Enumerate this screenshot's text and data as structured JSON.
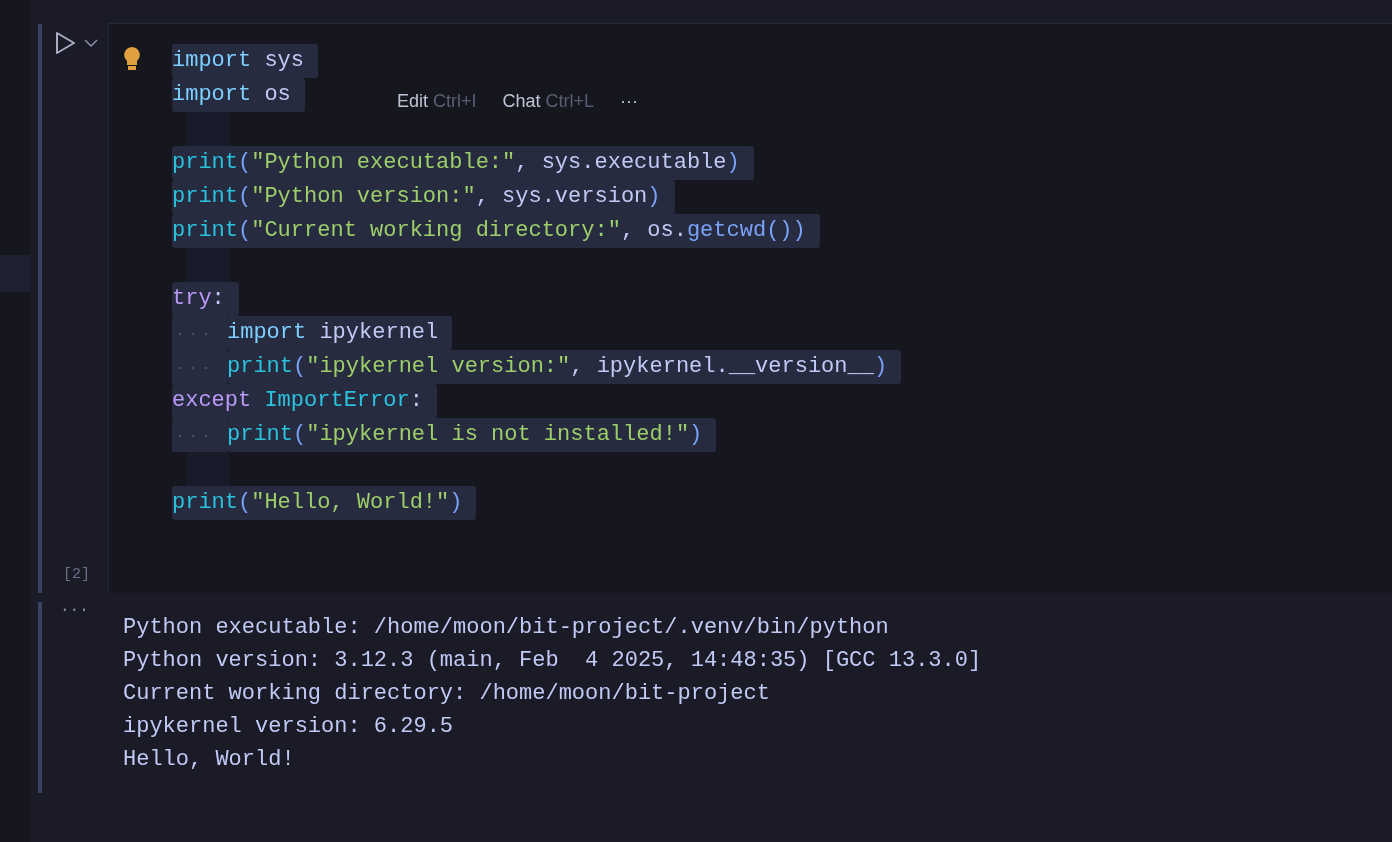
{
  "cell": {
    "execution_count": "[2]",
    "lines": [
      {
        "indented": false,
        "tokens": [
          {
            "kind": "keyword",
            "text": "import"
          },
          {
            "kind": "name",
            "text": " sys"
          }
        ]
      },
      {
        "indented": false,
        "tokens": [
          {
            "kind": "keyword",
            "text": "import"
          },
          {
            "kind": "name",
            "text": " os"
          }
        ]
      },
      {
        "kind": "blank",
        "indented": false
      },
      {
        "indented": false,
        "tokens": [
          {
            "kind": "func",
            "text": "print"
          },
          {
            "kind": "punct",
            "text": "("
          },
          {
            "kind": "string",
            "text": "\"Python executable:\""
          },
          {
            "kind": "name",
            "text": ", sys.executable"
          },
          {
            "kind": "punct",
            "text": ")"
          }
        ]
      },
      {
        "indented": false,
        "tokens": [
          {
            "kind": "func",
            "text": "print"
          },
          {
            "kind": "punct",
            "text": "("
          },
          {
            "kind": "string",
            "text": "\"Python version:\""
          },
          {
            "kind": "name",
            "text": ", sys.version"
          },
          {
            "kind": "punct",
            "text": ")"
          }
        ]
      },
      {
        "indented": false,
        "tokens": [
          {
            "kind": "func",
            "text": "print"
          },
          {
            "kind": "punct",
            "text": "("
          },
          {
            "kind": "string",
            "text": "\"Current working directory:\""
          },
          {
            "kind": "name",
            "text": ", os."
          },
          {
            "kind": "method",
            "text": "getcwd"
          },
          {
            "kind": "punct",
            "text": "())"
          }
        ]
      },
      {
        "kind": "blank",
        "indented": false
      },
      {
        "indented": false,
        "tokens": [
          {
            "kind": "control",
            "text": "try"
          },
          {
            "kind": "name",
            "text": ":"
          }
        ]
      },
      {
        "indented": true,
        "tokens": [
          {
            "kind": "keyword",
            "text": "import"
          },
          {
            "kind": "name",
            "text": " ipykernel"
          }
        ]
      },
      {
        "indented": true,
        "tokens": [
          {
            "kind": "func",
            "text": "print"
          },
          {
            "kind": "punct",
            "text": "("
          },
          {
            "kind": "string",
            "text": "\"ipykernel version:\""
          },
          {
            "kind": "name",
            "text": ", ipykernel.__version__"
          },
          {
            "kind": "punct",
            "text": ")"
          }
        ]
      },
      {
        "indented": false,
        "tokens": [
          {
            "kind": "control",
            "text": "except"
          },
          {
            "kind": "class",
            "text": " ImportError"
          },
          {
            "kind": "name",
            "text": ":"
          }
        ]
      },
      {
        "indented": true,
        "tokens": [
          {
            "kind": "func",
            "text": "print"
          },
          {
            "kind": "punct",
            "text": "("
          },
          {
            "kind": "string",
            "text": "\"ipykernel is not installed!\""
          },
          {
            "kind": "punct",
            "text": ")"
          }
        ]
      },
      {
        "kind": "blank",
        "indented": false
      },
      {
        "indented": false,
        "tokens": [
          {
            "kind": "func",
            "text": "print"
          },
          {
            "kind": "punct",
            "text": "("
          },
          {
            "kind": "string",
            "text": "\"Hello, World!\""
          },
          {
            "kind": "punct",
            "text": ")"
          }
        ]
      }
    ],
    "inline_toolbar": [
      {
        "label": "Edit",
        "shortcut": "Ctrl+I"
      },
      {
        "label": "Chat",
        "shortcut": "Ctrl+L"
      }
    ],
    "toolbar_more": "···"
  },
  "output": {
    "more": "···",
    "lines": [
      "Python executable: /home/moon/bit-project/.venv/bin/python",
      "Python version: 3.12.3 (main, Feb  4 2025, 14:48:35) [GCC 13.3.0]",
      "Current working directory: /home/moon/bit-project",
      "ipykernel version: 6.29.5",
      "Hello, World!"
    ]
  }
}
